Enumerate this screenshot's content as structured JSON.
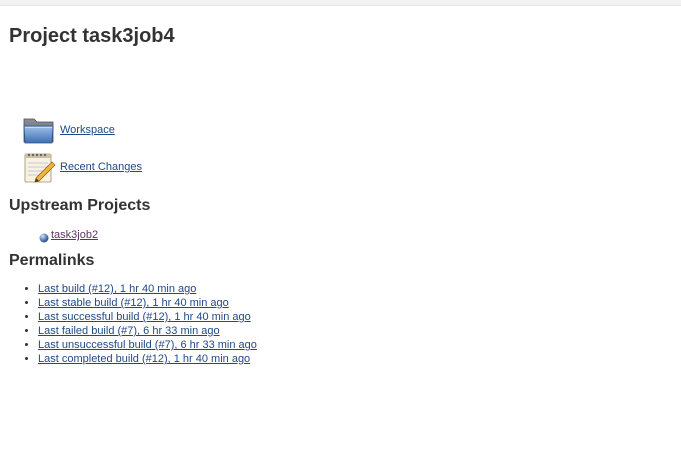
{
  "page": {
    "title": "Project task3job4"
  },
  "tasks": {
    "workspace": {
      "label": "Workspace",
      "icon": "folder-icon"
    },
    "recent_changes": {
      "label": "Recent Changes",
      "icon": "notepad-icon"
    }
  },
  "upstream": {
    "heading": "Upstream Projects",
    "items": [
      {
        "label": "task3job2",
        "icon": "blue-ball-icon"
      }
    ]
  },
  "permalinks": {
    "heading": "Permalinks",
    "items": [
      {
        "label": "Last build (#12), 1 hr 40 min ago"
      },
      {
        "label": "Last stable build (#12), 1 hr 40 min ago"
      },
      {
        "label": "Last successful build (#12), 1 hr 40 min ago"
      },
      {
        "label": "Last failed build (#7), 6 hr 33 min ago"
      },
      {
        "label": "Last unsuccessful build (#7), 6 hr 33 min ago"
      },
      {
        "label": "Last completed build (#12), 1 hr 40 min ago"
      }
    ]
  },
  "colors": {
    "link": "#204a87",
    "visited_link": "#5c3566",
    "text": "#333333",
    "background": "#ffffff"
  }
}
